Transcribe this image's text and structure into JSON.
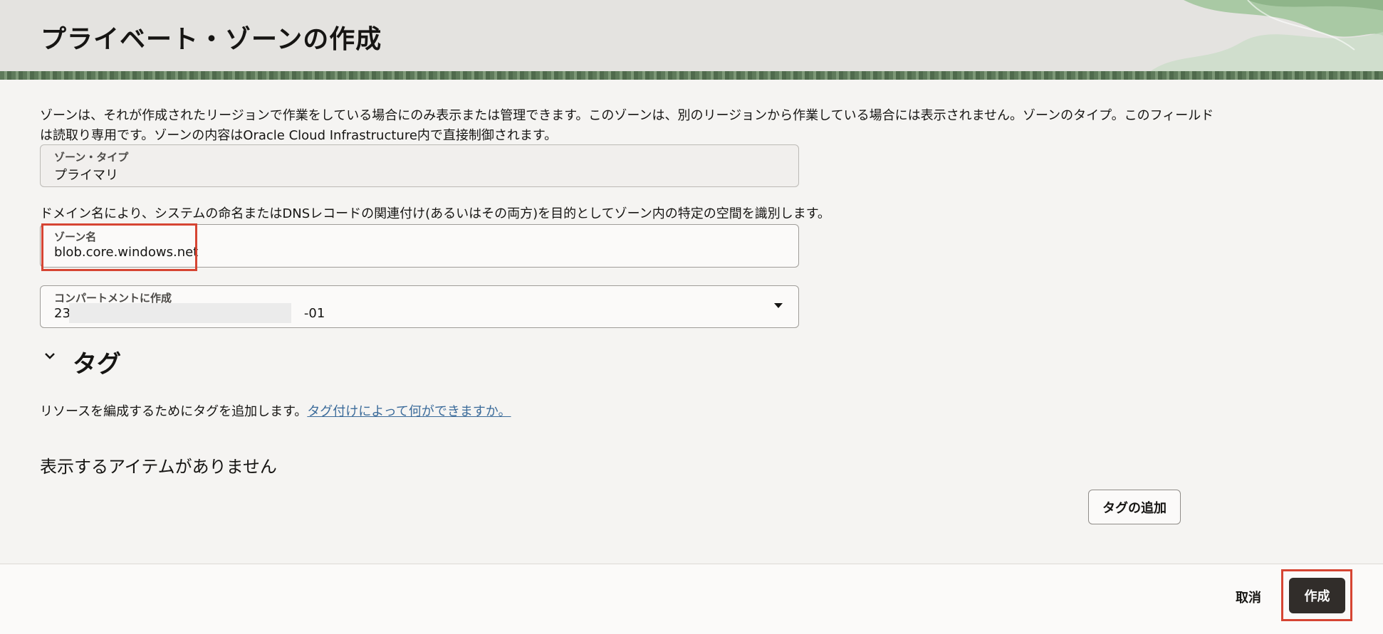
{
  "header": {
    "title": "プライベート・ゾーンの作成"
  },
  "form": {
    "intro_text": "ゾーンは、それが作成されたリージョンで作業をしている場合にのみ表示または管理できます。このゾーンは、別のリージョンから作業している場合には表示されません。ゾーンのタイプ。このフィールドは読取り専用です。ゾーンの内容はOracle Cloud Infrastructure内で直接制御されます。",
    "zone_type": {
      "label": "ゾーン・タイプ",
      "value": "プライマリ"
    },
    "domain_desc": "ドメイン名により、システムの命名またはDNSレコードの関連付け(あるいはその両方)を目的としてゾーン内の特定の空間を識別します。",
    "zone_name": {
      "label": "ゾーン名",
      "value": "blob.core.windows.net"
    },
    "compartment": {
      "label": "コンパートメントに作成",
      "value_prefix": "23",
      "value_suffix": "-01"
    }
  },
  "tags": {
    "heading": "タグ",
    "description": "リソースを編成するためにタグを追加します。",
    "link_text": "タグ付けによって何ができますか。",
    "empty_message": "表示するアイテムがありません",
    "add_button": "タグの追加"
  },
  "footer": {
    "cancel_label": "取消",
    "create_label": "作成"
  },
  "colors": {
    "highlight": "#d64533",
    "link": "#3b6b9a",
    "primary_button": "#312d2a"
  }
}
